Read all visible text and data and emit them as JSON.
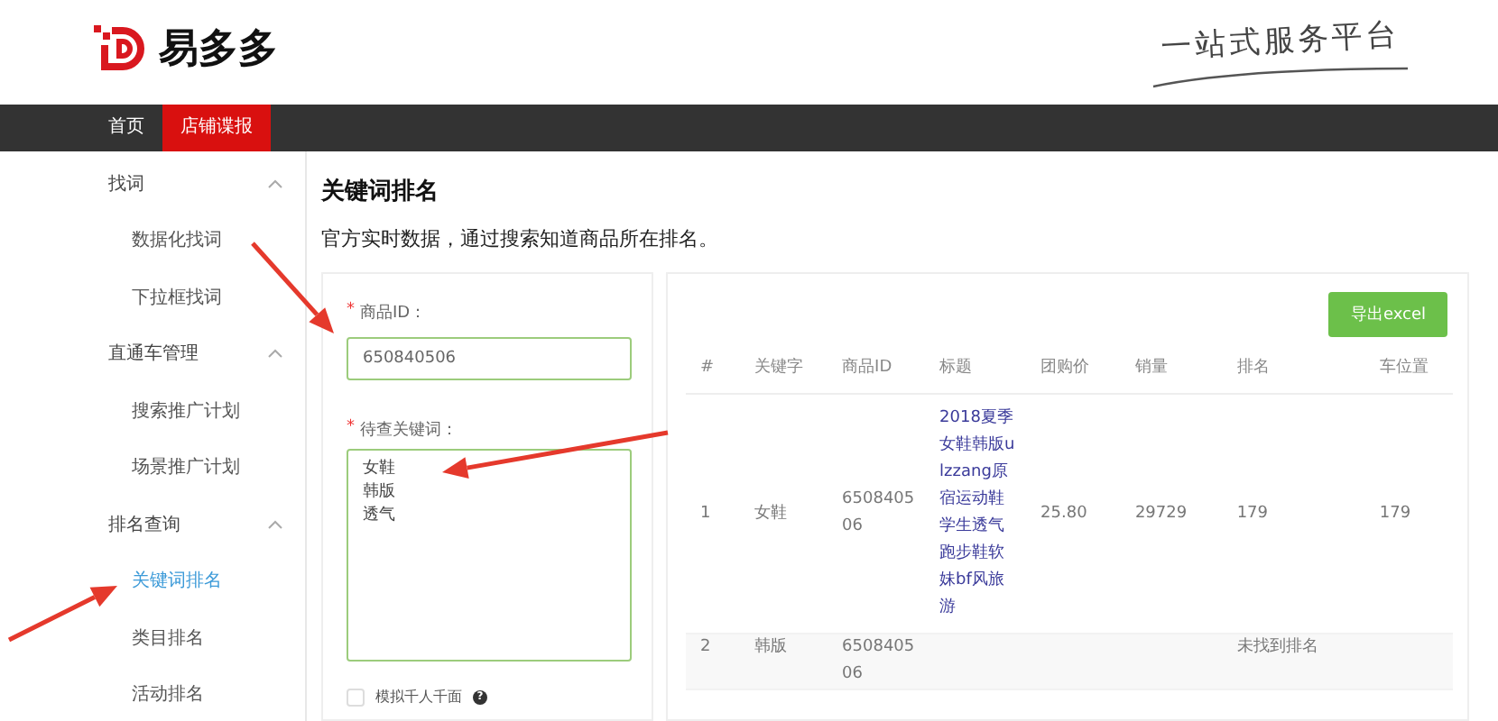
{
  "header": {
    "logo_text": "易多多",
    "slogan": "一站式服务平台"
  },
  "nav": [
    {
      "label": "首页",
      "selected": false
    },
    {
      "label": "店铺谍报",
      "selected": true
    }
  ],
  "sidebar": [
    {
      "label": "找词",
      "expanded": true,
      "children": [
        {
          "label": "数据化找词",
          "selected": false
        },
        {
          "label": "下拉框找词",
          "selected": false
        }
      ]
    },
    {
      "label": "直通车管理",
      "expanded": true,
      "children": [
        {
          "label": "搜索推广计划",
          "selected": false
        },
        {
          "label": "场景推广计划",
          "selected": false
        }
      ]
    },
    {
      "label": "排名查询",
      "expanded": true,
      "children": [
        {
          "label": "关键词排名",
          "selected": true
        },
        {
          "label": "类目排名",
          "selected": false
        },
        {
          "label": "活动排名",
          "selected": false
        }
      ]
    }
  ],
  "page": {
    "title": "关键词排名",
    "subtitle": "官方实时数据，通过搜索知道商品所在排名。"
  },
  "form": {
    "required_mark": "*",
    "id_label": "商品ID：",
    "id_value": "650840506",
    "keywords_label": "待查关键词：",
    "keywords_lines": [
      "女鞋",
      "韩版",
      "透气"
    ],
    "checkbox": {
      "label": "模拟千人千面",
      "checked": false,
      "help_icon": "?"
    }
  },
  "table": {
    "export_button": "导出excel",
    "columns": [
      "#",
      "关键字",
      "商品ID",
      "标题",
      "团购价",
      "销量",
      "排名",
      "车位置"
    ],
    "rows": [
      [
        "1",
        "女鞋",
        "650840506",
        "2018夏季女鞋韩版ulzzang原宿运动鞋学生透气跑步鞋软妹bf风旅游",
        "25.80",
        "29729",
        "179",
        "179"
      ],
      [
        "2",
        "韩版",
        "650840506",
        null,
        null,
        null,
        "未找到排名",
        null
      ]
    ]
  },
  "annotations": [
    {
      "kind": "arrow"
    },
    {
      "kind": "arrow"
    },
    {
      "kind": "arrow"
    }
  ]
}
